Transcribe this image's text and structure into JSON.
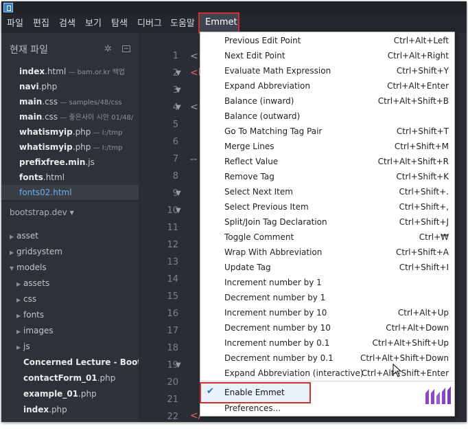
{
  "menubar": {
    "items": [
      "파일",
      "편집",
      "검색",
      "보기",
      "탐색",
      "디버그",
      "도움말"
    ],
    "emmet": "Emmet"
  },
  "sidebar": {
    "title": "현재 파일",
    "open_files": [
      {
        "name": "index",
        "ext": ".html",
        "path": " — bam.or.kr 백업"
      },
      {
        "name": "navi",
        "ext": ".php",
        "path": ""
      },
      {
        "name": "main",
        "ext": ".css",
        "path": " — samples/48/css"
      },
      {
        "name": "main",
        "ext": ".css",
        "path": " — 좋은사이 시안 01/48/"
      },
      {
        "name": "whatismyip",
        "ext": ".php",
        "path": " — I:/tmp"
      },
      {
        "name": "whatismyip",
        "ext": ".php",
        "path": " — I:/tmp"
      },
      {
        "name": "prefixfree.min",
        "ext": ".js",
        "path": ""
      },
      {
        "name": "fonts",
        "ext": ".html",
        "path": ""
      },
      {
        "name": "fonts02",
        "ext": ".html",
        "path": ""
      }
    ],
    "project": "bootstrap.dev ▾",
    "tree": [
      {
        "label": "asset",
        "arrow": "▶",
        "indent": 0,
        "kind": "folder"
      },
      {
        "label": "gridsystem",
        "arrow": "▶",
        "indent": 0,
        "kind": "folder"
      },
      {
        "label": "models",
        "arrow": "▼",
        "indent": 0,
        "kind": "folder"
      },
      {
        "label": "assets",
        "arrow": "▶",
        "indent": 1,
        "kind": "folder"
      },
      {
        "label": "css",
        "arrow": "▶",
        "indent": 1,
        "kind": "folder"
      },
      {
        "label": "fonts",
        "arrow": "▶",
        "indent": 1,
        "kind": "folder"
      },
      {
        "label": "images",
        "arrow": "▶",
        "indent": 1,
        "kind": "folder"
      },
      {
        "label": "js",
        "arrow": "▶",
        "indent": 1,
        "kind": "folder"
      },
      {
        "label": "Concerned Lecture - Bootstrap",
        "arrow": "",
        "indent": 1,
        "kind": "file"
      },
      {
        "label": "contactForm_01",
        "ext": ".php",
        "arrow": "",
        "indent": 1,
        "kind": "file"
      },
      {
        "label": "example_01",
        "ext": ".php",
        "arrow": "",
        "indent": 1,
        "kind": "file"
      },
      {
        "label": "index",
        "ext": ".php",
        "arrow": "",
        "indent": 1,
        "kind": "file"
      }
    ]
  },
  "editor": {
    "line_numbers": [
      "1",
      "2",
      "3",
      "4",
      "5",
      "6",
      "7",
      "8",
      "9",
      "10",
      "11",
      "12",
      "13",
      "14",
      "15",
      "16",
      "17",
      "18",
      "19",
      "20",
      "21",
      "22"
    ]
  },
  "emmet_menu": {
    "items": [
      {
        "label": "Previous Edit Point",
        "shortcut": "Ctrl+Alt+Left"
      },
      {
        "label": "Next Edit Point",
        "shortcut": "Ctrl+Alt+Right"
      },
      {
        "label": "Evaluate Math Expression",
        "shortcut": "Ctrl+Shift+Y"
      },
      {
        "label": "Expand Abbreviation",
        "shortcut": "Ctrl+Alt+Enter"
      },
      {
        "label": "Balance (inward)",
        "shortcut": "Ctrl+Alt+Shift+B"
      },
      {
        "label": "Balance (outward)",
        "shortcut": ""
      },
      {
        "label": "Go To Matching Tag Pair",
        "shortcut": "Ctrl+Shift+T"
      },
      {
        "label": "Merge Lines",
        "shortcut": "Ctrl+Shift+M"
      },
      {
        "label": "Reflect Value",
        "shortcut": "Ctrl+Alt+Shift+R"
      },
      {
        "label": "Remove Tag",
        "shortcut": "Ctrl+Shift+K"
      },
      {
        "label": "Select Next Item",
        "shortcut": "Ctrl+Shift+."
      },
      {
        "label": "Select Previous Item",
        "shortcut": "Ctrl+Shift+,"
      },
      {
        "label": "Split/Join Tag Declaration",
        "shortcut": "Ctrl+Shift+J"
      },
      {
        "label": "Toggle Comment",
        "shortcut": "Ctrl+₩"
      },
      {
        "label": "Wrap With Abbreviation",
        "shortcut": "Ctrl+Shift+A"
      },
      {
        "label": "Update Tag",
        "shortcut": "Ctrl+Shift+I"
      },
      {
        "label": "Increment number by 1",
        "shortcut": ""
      },
      {
        "label": "Decrement number by 1",
        "shortcut": ""
      },
      {
        "label": "Increment number by 10",
        "shortcut": "Ctrl+Alt+Up"
      },
      {
        "label": "Decrement number by 10",
        "shortcut": "Ctrl+Alt+Down"
      },
      {
        "label": "Increment number by 0.1",
        "shortcut": "Ctrl+Alt+Shift+Up"
      },
      {
        "label": "Decrement number by 0.1",
        "shortcut": "Ctrl+Alt+Shift+Down"
      },
      {
        "label": "Expand Abbreviation (interactive)",
        "shortcut": "Ctrl+Alt+Shift+Enter"
      }
    ],
    "enable_emmet": "Enable Emmet",
    "enable_emmet_checked": true,
    "preferences": "Preferences..."
  },
  "colors": {
    "highlight_border": "#d32f2f",
    "active_file": "#6ab0f3",
    "emmet_logo": "#8e44c9"
  }
}
